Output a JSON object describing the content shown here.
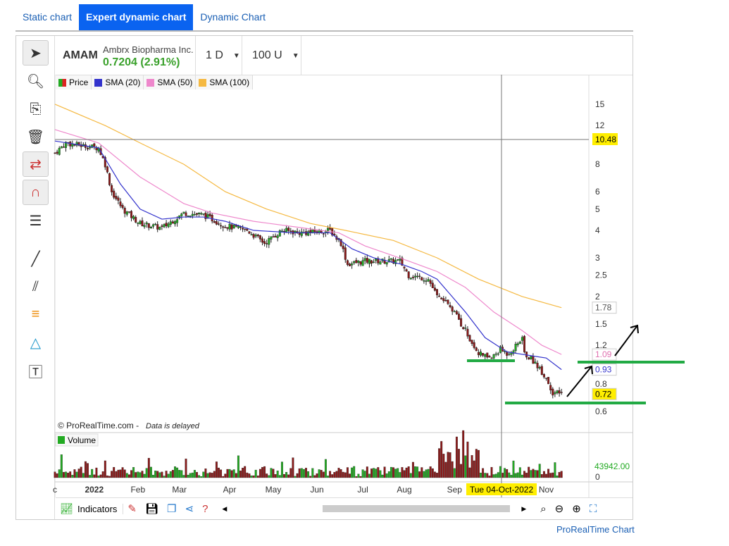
{
  "tabs": [
    "Static chart",
    "Expert dynamic chart",
    "Dynamic Chart"
  ],
  "header": {
    "symbol": "AMAM",
    "name": "Ambrx Biopharma Inc.",
    "quote": "0.7204 (2.91%)",
    "period": "1 D",
    "units": "100 U"
  },
  "legend": [
    {
      "label": "Price",
      "color": "#22aa22"
    },
    {
      "label": "SMA (20)",
      "color": "#3333cc"
    },
    {
      "label": "SMA (50)",
      "color": "#ee88cc"
    },
    {
      "label": "SMA (100)",
      "color": "#f5b942"
    }
  ],
  "watermark": "© ProRealTime.com -",
  "delayed": "Data is delayed",
  "volume_label": "Volume",
  "volume_value": "43942.00",
  "volume_zero": "0",
  "crosshair_date": "Tue 04-Oct-2022",
  "crosshair_price": "10.48",
  "indicators_label": "Indicators",
  "footer_link": "ProRealTime Chart",
  "chart_data": {
    "type": "candlestick",
    "yscale": "log",
    "ylim": [
      0.55,
      18
    ],
    "y_ticks": [
      "15",
      "12",
      "8",
      "6",
      "5",
      "4",
      "3",
      "2.5",
      "2",
      "1.5",
      "1.2",
      "0.8",
      "0.6"
    ],
    "x_ticks": [
      {
        "label": "c",
        "t": 0
      },
      {
        "label": "2022",
        "t": 18
      },
      {
        "label": "Feb",
        "t": 38
      },
      {
        "label": "Mar",
        "t": 57
      },
      {
        "label": "Apr",
        "t": 80
      },
      {
        "label": "May",
        "t": 100
      },
      {
        "label": "Jun",
        "t": 120
      },
      {
        "label": "Jul",
        "t": 141
      },
      {
        "label": "Aug",
        "t": 160
      },
      {
        "label": "Sep",
        "t": 183
      },
      {
        "label": "Nov",
        "t": 225
      }
    ],
    "price_labels": [
      {
        "value": "1.78",
        "series": "SMA (100)",
        "color": "#555",
        "bg": "#fff"
      },
      {
        "value": "1.09",
        "series": "SMA (50)",
        "color": "#e070b0",
        "bg": "#fff"
      },
      {
        "value": "0.93",
        "series": "SMA (20)",
        "color": "#3333cc",
        "bg": "#fff"
      },
      {
        "value": "0.72",
        "series": "Price",
        "color": "#000",
        "bg": "#ffee00"
      }
    ],
    "price_keypoints": [
      [
        0,
        9
      ],
      [
        5,
        10
      ],
      [
        10,
        9.8
      ],
      [
        20,
        9.5
      ],
      [
        23,
        8
      ],
      [
        26,
        6
      ],
      [
        31,
        5
      ],
      [
        39,
        4.3
      ],
      [
        49,
        4.1
      ],
      [
        59,
        4.8
      ],
      [
        68,
        4.7
      ],
      [
        78,
        4.2
      ],
      [
        88,
        4.0
      ],
      [
        96,
        3.5
      ],
      [
        104,
        4.0
      ],
      [
        113,
        3.9
      ],
      [
        126,
        4.0
      ],
      [
        131,
        3.5
      ],
      [
        134,
        2.8
      ],
      [
        142,
        2.9
      ],
      [
        149,
        2.9
      ],
      [
        158,
        2.9
      ],
      [
        162,
        2.5
      ],
      [
        171,
        2.4
      ],
      [
        175,
        2.0
      ],
      [
        181,
        1.8
      ],
      [
        188,
        1.4
      ],
      [
        194,
        1.1
      ],
      [
        200,
        1.05
      ],
      [
        204,
        1.15
      ],
      [
        207,
        1.1
      ],
      [
        210,
        1.15
      ],
      [
        214,
        1.3
      ],
      [
        215,
        1.1
      ],
      [
        220,
        1.0
      ],
      [
        225,
        0.85
      ],
      [
        228,
        0.73
      ],
      [
        232,
        0.72
      ]
    ],
    "sma20": [
      [
        0,
        10.2
      ],
      [
        20,
        9.5
      ],
      [
        30,
        6.5
      ],
      [
        39,
        5
      ],
      [
        49,
        4.5
      ],
      [
        59,
        4.6
      ],
      [
        68,
        4.6
      ],
      [
        78,
        4.4
      ],
      [
        91,
        4.0
      ],
      [
        110,
        3.9
      ],
      [
        126,
        3.9
      ],
      [
        136,
        3.3
      ],
      [
        146,
        3.0
      ],
      [
        159,
        2.8
      ],
      [
        168,
        2.6
      ],
      [
        175,
        2.4
      ],
      [
        188,
        1.7
      ],
      [
        197,
        1.3
      ],
      [
        207,
        1.12
      ],
      [
        217,
        1.08
      ],
      [
        225,
        1.05
      ],
      [
        232,
        0.93
      ]
    ],
    "sma50": [
      [
        0,
        11.5
      ],
      [
        20,
        10
      ],
      [
        39,
        7
      ],
      [
        59,
        5.3
      ],
      [
        72,
        4.8
      ],
      [
        91,
        4.4
      ],
      [
        110,
        4.15
      ],
      [
        130,
        3.9
      ],
      [
        142,
        3.4
      ],
      [
        162,
        2.9
      ],
      [
        175,
        2.6
      ],
      [
        188,
        2.2
      ],
      [
        201,
        1.7
      ],
      [
        214,
        1.4
      ],
      [
        223,
        1.2
      ],
      [
        232,
        1.09
      ]
    ],
    "sma100": [
      [
        0,
        15
      ],
      [
        23,
        12
      ],
      [
        39,
        10
      ],
      [
        59,
        8
      ],
      [
        78,
        6
      ],
      [
        97,
        5
      ],
      [
        117,
        4.3
      ],
      [
        133,
        4.0
      ],
      [
        155,
        3.6
      ],
      [
        175,
        3.0
      ],
      [
        194,
        2.4
      ],
      [
        214,
        2.0
      ],
      [
        232,
        1.78
      ]
    ],
    "volume_max": 120000
  }
}
